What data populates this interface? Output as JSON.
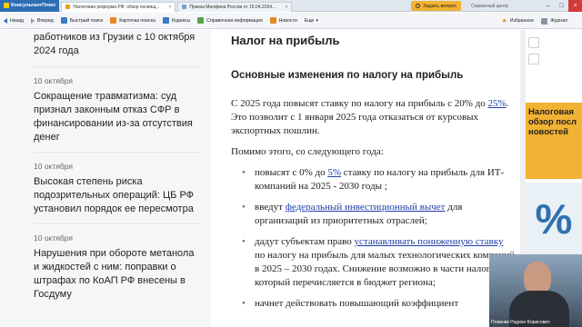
{
  "app": {
    "logo_text": "КонсультантПлюс",
    "tabs": [
      {
        "label": "Налоговая реформа РФ: обзор посвящ..."
      },
      {
        "label": "Приказ Минфина России от 15.04.2024..."
      }
    ],
    "ask_button": "Задать вопрос",
    "service_center": "Сервисный центр"
  },
  "toolbar": {
    "back": "Назад",
    "forward": "Вперед",
    "quick_search": "Быстрый поиск",
    "search_card": "Карточка поиска",
    "codes": "Кодексы",
    "reference": "Справочная информация",
    "news": "Новости",
    "more": "Еще",
    "favorites": "Избранное",
    "journal": "Журнал"
  },
  "sidebar": {
    "items": [
      {
        "date": "",
        "title_lines": [
          "работников из Грузии с 10 октября",
          "2024 года"
        ]
      },
      {
        "date": "10 октября",
        "title_lines": [
          "Сокращение травматизма: суд",
          "признал законным отказ СФР в",
          "финансировании из-за отсутствия",
          "денег"
        ]
      },
      {
        "date": "10 октября",
        "title_lines": [
          "Высокая степень риска",
          "подозрительных операций: ЦБ РФ",
          "установил порядок ее пересмотра"
        ]
      },
      {
        "date": "10 октября",
        "title_lines": [
          "Нарушения при обороте метанола",
          "и жидкостей с ним: поправки о",
          "штрафах по КоАП РФ внесены в",
          "Госдуму"
        ]
      }
    ]
  },
  "document": {
    "h1": "Налог на прибыль",
    "h2": "Основные изменения по налогу на прибыль",
    "p1": {
      "before": "С 2025 года повысят ставку по налогу на прибыль с 20% до ",
      "link": "25%",
      "after": ". Это позволит с 1 января 2025 года отказаться от курсовых экспортных пошлин."
    },
    "p2": "Помимо этого, со следующего года:",
    "bullets": [
      {
        "before": "повысят с 0% до ",
        "link": "5%",
        "after": " ставку по налогу на прибыль для ИТ-компаний на 2025 - 2030 годы ;"
      },
      {
        "before": "введут ",
        "link": "федеральный инвестиционный вычет",
        "after": " для организаций из приоритетных отраслей;"
      },
      {
        "before": "дадут субъектам право ",
        "link": "устанавливать пониженную ставку",
        "after": " по налогу на прибыль для малых технологических компаний в 2025 – 2030 годах. Снижение возможно в части налога, который перечисляется в бюджет региона;"
      },
      {
        "before": "начнет действовать повышающий коэффициент",
        "link": "",
        "after": ""
      }
    ]
  },
  "promo": {
    "text": "Налоговая обзор посл новостей",
    "percent_glyph": "%"
  },
  "webcam": {
    "name": "Плавник Радион Борисович"
  }
}
